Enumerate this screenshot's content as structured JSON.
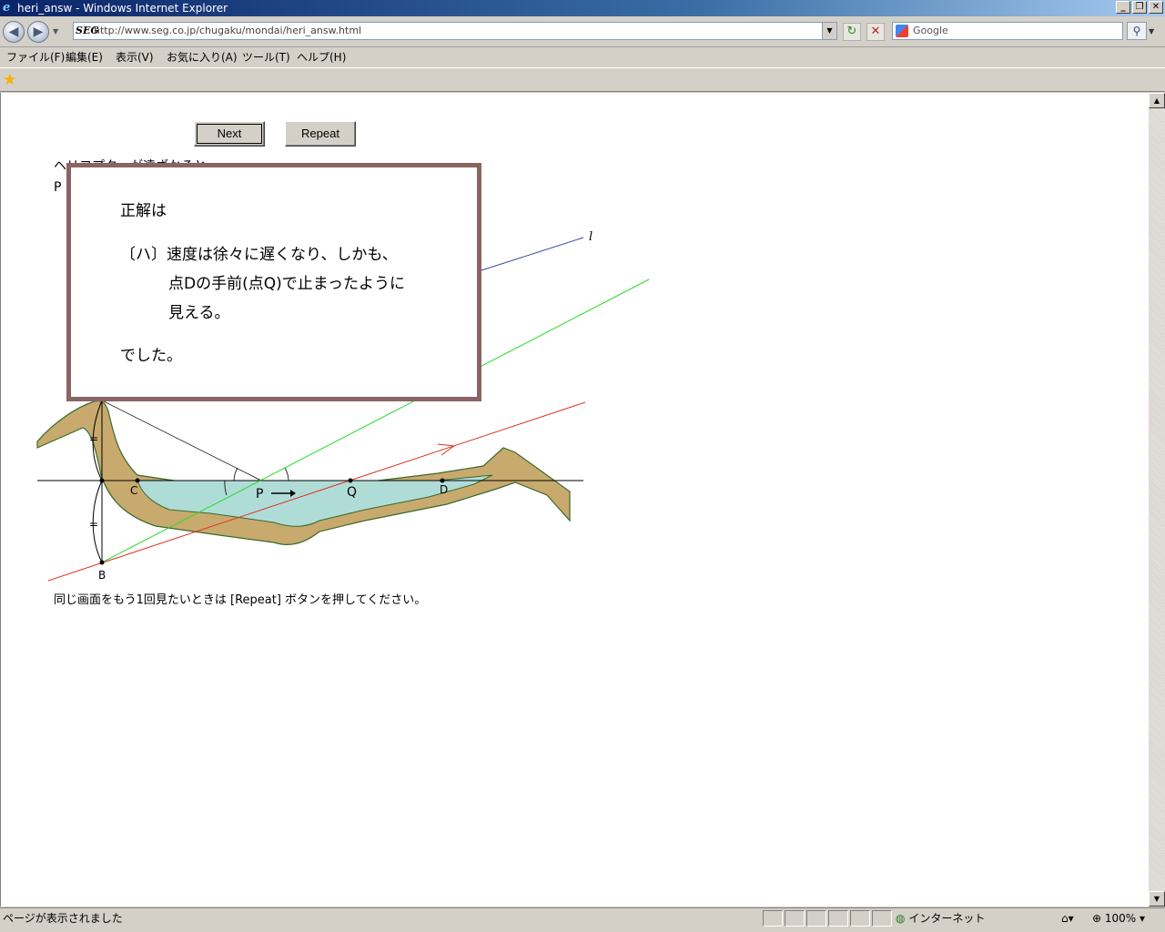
{
  "window": {
    "title": "heri_answ - Windows Internet Explorer",
    "app_icon": "ie-icon",
    "minimize": "_",
    "restore": "❐",
    "close": "✕"
  },
  "addressbar": {
    "back": "◀",
    "forward": "▶",
    "logo": "SEG",
    "url": "http://www.seg.co.jp/chugaku/mondai/heri_answ.html",
    "dropdown": "▼",
    "refresh": "↻",
    "stop": "✕",
    "search_placeholder": "Google",
    "search_go": "⚲",
    "search_dd": "▼"
  },
  "menu": {
    "file": "ファイル(F)",
    "edit": "編集(E)",
    "view": "表示(V)",
    "favorites": "お気に入り(A)",
    "tools": "ツール(T)",
    "help": "ヘルプ(H)"
  },
  "favbar": {
    "star": "★"
  },
  "page": {
    "next_label": "Next",
    "repeat_label": "Repeat",
    "intro_line1": "ヘリコプターが遠ざかると",
    "intro_line2": "P",
    "footnote": "同じ画面をもう1回見たいときは [Repeat] ボタンを押してください。"
  },
  "popup": {
    "line1": "正解は",
    "line2": "〔ハ〕速度は徐々に遅くなり、しかも、",
    "line3": "点Dの手前(点Q)で止まったように",
    "line4": "見える。",
    "line5": "でした。"
  },
  "diagram": {
    "label_l": "l",
    "label_c": "C",
    "label_p": "P",
    "label_q": "Q",
    "label_d": "D",
    "label_b": "B",
    "tick_mark_top": "=",
    "tick_mark_bottom": "=",
    "colors": {
      "bank": "#c8aa6e",
      "bank_edge": "#3a6a2a",
      "water": "#b0dcd8",
      "line_l": "#3a4a9a",
      "line_green": "#22dd22",
      "line_red": "#dd3322"
    }
  },
  "status": {
    "text": "ページが表示されました",
    "zone": "インターネット",
    "zone_icon": "globe-icon",
    "zoom": "100%"
  }
}
